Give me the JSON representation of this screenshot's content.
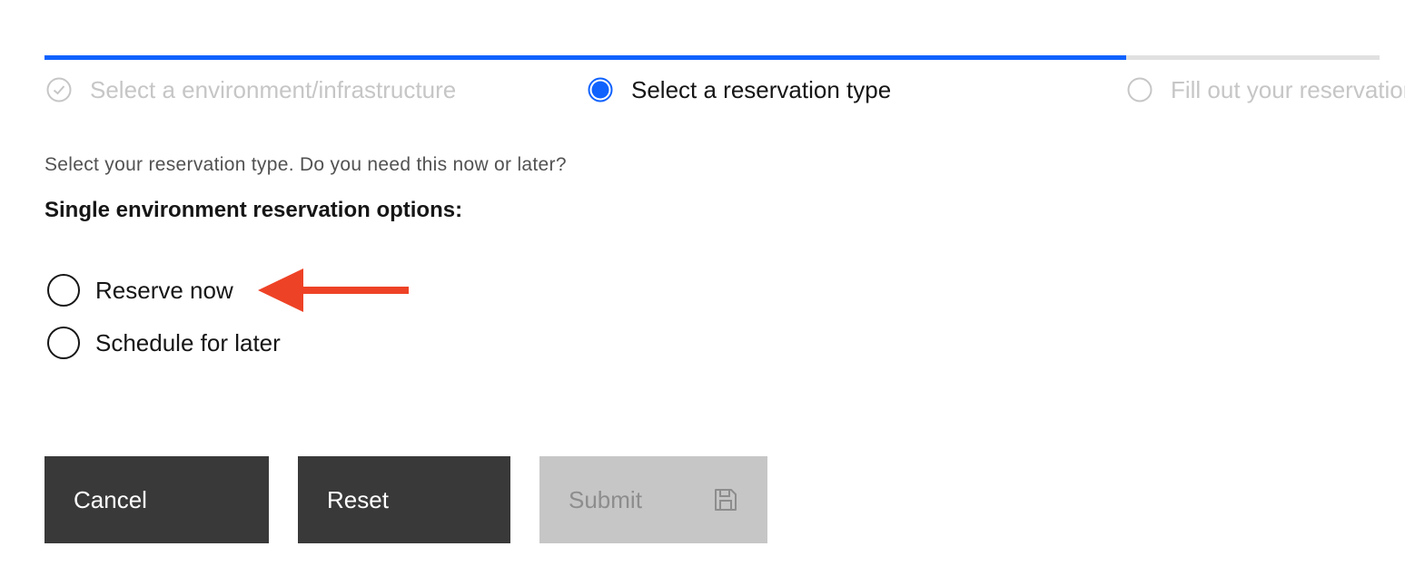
{
  "progress": {
    "fill_fraction": 0.81,
    "steps": [
      {
        "label": "Select a environment/infrastructure",
        "state": "complete",
        "icon": "checkmark-outline-icon"
      },
      {
        "label": "Select a reservation type",
        "state": "current",
        "icon": "current-step-icon"
      },
      {
        "label": "Fill out your reservation details",
        "state": "incomplete",
        "icon": "circle-outline-icon"
      }
    ]
  },
  "form": {
    "instructions": "Select your reservation type. Do you need this now or later?",
    "section_title": "Single environment reservation options:",
    "options": [
      {
        "label": "Reserve now",
        "selected": false
      },
      {
        "label": "Schedule for later",
        "selected": false
      }
    ]
  },
  "annotation": {
    "icon": "arrow-left-icon",
    "color": "#ee4226"
  },
  "actions": {
    "cancel_label": "Cancel",
    "reset_label": "Reset",
    "submit_label": "Submit",
    "submit_icon": "save-icon",
    "submit_disabled": true
  },
  "colors": {
    "accent": "#0f62fe",
    "button_dark": "#393939",
    "button_disabled": "#c6c6c6"
  }
}
